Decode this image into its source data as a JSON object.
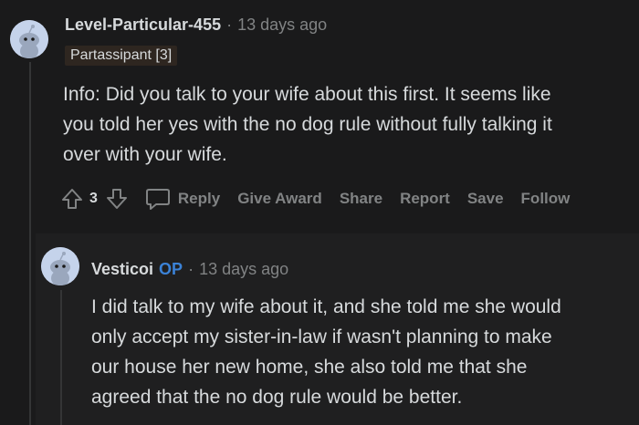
{
  "comment1": {
    "username": "Level-Particular-455",
    "time": "13 days ago",
    "flair": "Partassipant [3]",
    "body_lines": [
      "Info: Did you talk to your wife about this first. It seems like",
      "you told her yes with the no dog rule without fully talking it",
      "over with your wife."
    ],
    "score": "3",
    "actions": {
      "reply": "Reply",
      "give_award": "Give Award",
      "share": "Share",
      "report": "Report",
      "save": "Save",
      "follow": "Follow"
    }
  },
  "comment2": {
    "username": "Vesticoi",
    "op_badge": "OP",
    "time": "13 days ago",
    "body_lines": [
      "I did talk to my wife about it, and she told me she would",
      "only accept my sister-in-law if wasn't planning to make",
      "our house her new home, she also told me that she",
      "agreed that the no dog rule would be better."
    ]
  },
  "separator": "·",
  "icons": {
    "avatar": "snoo-avatar-icon",
    "upvote": "upvote-arrow-icon",
    "downvote": "downvote-arrow-icon",
    "reply": "comment-bubble-icon"
  }
}
